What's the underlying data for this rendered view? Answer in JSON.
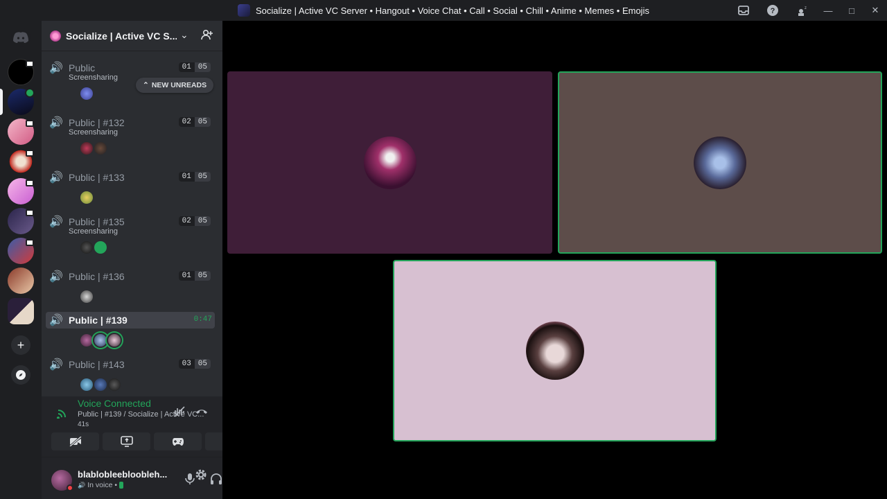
{
  "window": {
    "title": "Socialize | Active VC Server • Hangout • Voice Chat • Call • Social • Chill • Anime • Memes • Emojis"
  },
  "server": {
    "name": "Socialize | Active VC S..."
  },
  "new_unreads_label": "NEW UNREADS",
  "channels": [
    {
      "name": "Public",
      "sub": "Screensharing",
      "count_a": "01",
      "count_b": "05"
    },
    {
      "name": "Public | #132",
      "sub": "Screensharing",
      "count_a": "02",
      "count_b": "05"
    },
    {
      "name": "Public | #133",
      "sub": "",
      "count_a": "01",
      "count_b": "05"
    },
    {
      "name": "Public | #135",
      "sub": "Screensharing",
      "count_a": "02",
      "count_b": "05"
    },
    {
      "name": "Public | #136",
      "sub": "",
      "count_a": "01",
      "count_b": "05"
    },
    {
      "name": "Public | #139",
      "sub": "",
      "timer": "0:47"
    },
    {
      "name": "Public | #143",
      "sub": "",
      "count_a": "03",
      "count_b": "05"
    }
  ],
  "voice": {
    "status": "Voice Connected",
    "channel": "Public | #139 / Socialize | Active VC...",
    "elapsed": "41s"
  },
  "user": {
    "name": "blablobleebloobleh...",
    "state": "In voice •"
  },
  "colors": {
    "accent_green": "#23a55a",
    "tile1_bg": "#3f1e38",
    "tile2_bg": "#5d4d4a",
    "tile3_bg": "#d7c0d1"
  }
}
